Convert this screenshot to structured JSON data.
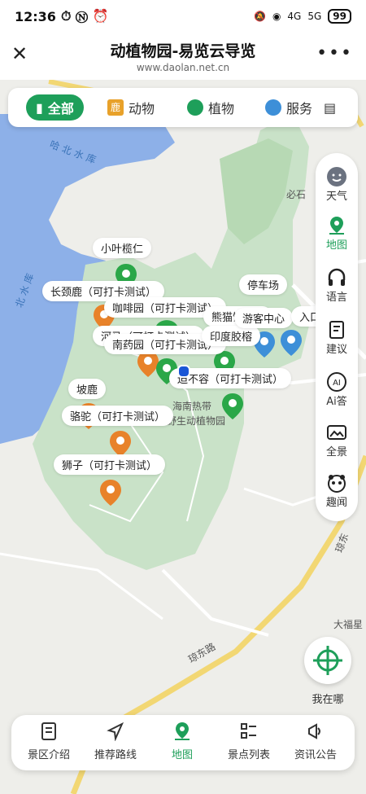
{
  "status": {
    "time": "12:36",
    "net1": "4G",
    "net2": "5G",
    "battery": "99"
  },
  "title": {
    "main": "动植物园-易览云导览",
    "url": "www.daolan.net.cn"
  },
  "filters": [
    "全部",
    "动物",
    "植物",
    "服务"
  ],
  "side": [
    {
      "label": "天气",
      "icon": "weather-icon"
    },
    {
      "label": "地图",
      "icon": "map-pin-icon"
    },
    {
      "label": "语言",
      "icon": "headphones-icon"
    },
    {
      "label": "建议",
      "icon": "note-icon"
    },
    {
      "label": "Ai答",
      "icon": "ai-icon"
    },
    {
      "label": "全景",
      "icon": "panorama-icon"
    },
    {
      "label": "趣闻",
      "icon": "panda-icon"
    }
  ],
  "locate_label": "我在哪",
  "nav": [
    {
      "label": "景区介绍"
    },
    {
      "label": "推荐路线"
    },
    {
      "label": "地图"
    },
    {
      "label": "景点列表"
    },
    {
      "label": "资讯公告"
    }
  ],
  "map_labels": {
    "xiaoye": "小叶榄仁",
    "changjing": "长颈鹿（可打卡测试）",
    "kafei": "咖啡园（可打卡测试）",
    "hema": "河马（可打卡测试）",
    "nanyao": "南药园（可打卡测试）",
    "meili": "熊猫馆（可",
    "yindu": "印度胶榕",
    "burong": "迫不容（可打卡测试）",
    "polu": "坡鹿",
    "luotuo": "骆驼（可打卡测试）",
    "shizi": "狮子（可打卡测试）",
    "tingchechang": "停车场",
    "youke": "游客中心",
    "rukou": "入口"
  },
  "map_text": {
    "water": "哈 北 水 库",
    "water2": "北 水 库",
    "bishi": "必石",
    "hainan": "海南热带",
    "yesheng": "野生动植物园",
    "dafu": "大福星",
    "road": "琼东路",
    "road2": "琼东"
  },
  "colors": {
    "accent": "#1e9f5a",
    "animal": "#e8822a",
    "plant": "#2aa748",
    "service": "#3d8fd8"
  }
}
